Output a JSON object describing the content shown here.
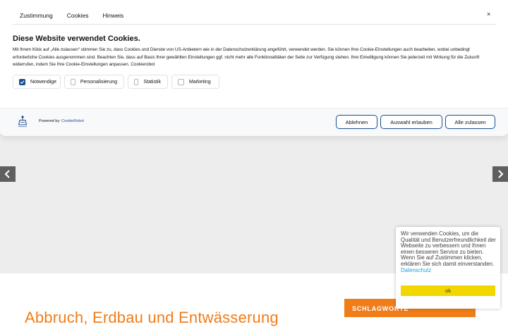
{
  "dialog": {
    "tabs": [
      "Zustimmung",
      "Cookies",
      "Hinweis"
    ],
    "close_label": "×",
    "title": "Diese Website verwendet Cookies.",
    "body": "Mit Ihrem Klick auf „Alle zulassen“ stimmen Sie zu, dass Cookies und Dienste von US-Anbietern wie in der Datenschutzerklärung angeführt, verwendet werden. Sie können Ihre Cookie-Einstellungen auch bearbeiten, wobei unbedingt erforderliche Cookies ausgenommen sind. Beachten Sie, dass auf Basis Ihrer gewählten Einstellungen ggf. nicht mehr alle Funktionalitäten der Seite zur Verfügung stehen. Ihre Einwilligung können Sie jederzeit mit Wirkung für die Zukunft widerrufen, indem Sie Ihre Cookie-Einstellungen anpassen. Cookierobot",
    "consents": [
      {
        "label": "Notwendige",
        "checked": true
      },
      {
        "label": "Personalisierung",
        "checked": false
      },
      {
        "label": "Statistik",
        "checked": false
      },
      {
        "label": "Marketing",
        "checked": false
      }
    ],
    "powered_prefix": "Powered by:",
    "powered_link": "CookieRobot",
    "buttons": {
      "decline": "Ablehnen",
      "allow_selection": "Auswahl erlauben",
      "allow_all": "Alle zulassen"
    },
    "accent_color": "#1a4f8f"
  },
  "page": {
    "heading": "Abbruch, Erdbau und Entwässerung",
    "tags_label": "SCHLAGWORTE",
    "accent_color": "#f07d1a"
  },
  "notice": {
    "text": "Wir verwenden Cookies, um die Qualität und Benutzerfreundlichkeit der Webseite zu verbessern und Ihnen einen besseren Service zu bieten. Wenn Sie auf Zustimmen klicken, erklären Sie sich damit einverstanden.",
    "link": "Datenschutz",
    "ok_label": "ok",
    "button_color": "#f1d600"
  },
  "icons": {
    "slider_prev": "chevron-left-icon",
    "slider_next": "chevron-right-icon",
    "logo": "cookierobot-logo-icon",
    "checkbox": "checkmark-icon"
  }
}
